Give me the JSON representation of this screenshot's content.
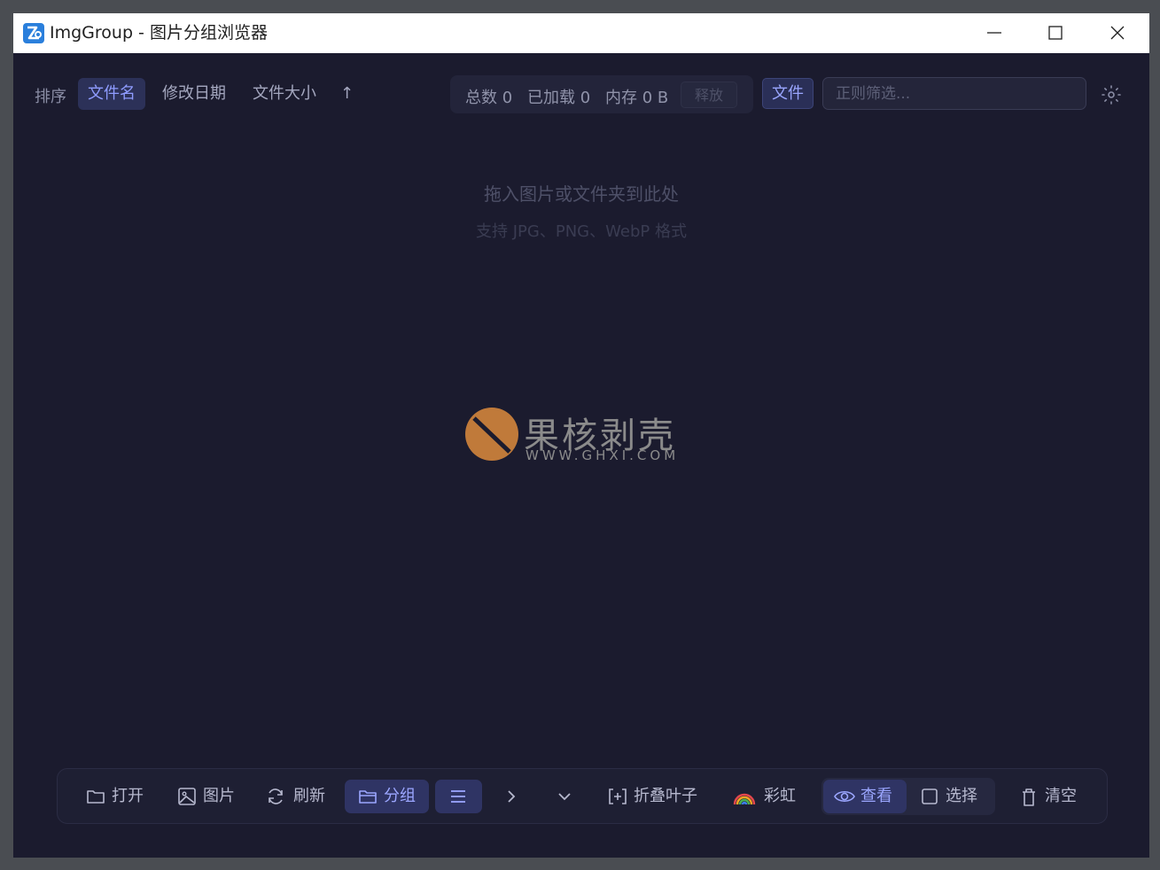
{
  "window": {
    "title": "ImgGroup - 图片分组浏览器",
    "controls": [
      "minimize",
      "maximize",
      "close"
    ]
  },
  "toolbar": {
    "sort_label": "排序",
    "sort_options": [
      {
        "label": "文件名",
        "active": true
      },
      {
        "label": "修改日期",
        "active": false
      },
      {
        "label": "文件大小",
        "active": false
      }
    ],
    "sort_direction": "↑",
    "stats": {
      "total": "总数 0",
      "loaded": "已加载 0",
      "memory": "内存 0 B",
      "release_label": "释放"
    },
    "file_button": "文件",
    "filter_placeholder": "正则筛选...",
    "settings_icon": "settings-icon"
  },
  "empty_state": {
    "title": "拖入图片或文件夹到此处",
    "subtitle": "支持 JPG、PNG、WebP 格式"
  },
  "watermark": {
    "cn": "果核剥壳",
    "en": "WWW.GHXI.COM"
  },
  "bottom_toolbar": {
    "open": "打开",
    "image": "图片",
    "refresh": "刷新",
    "group": "分组",
    "fold_leaves": "折叠叶子",
    "rainbow": "彩虹",
    "view": "查看",
    "select": "选择",
    "clear": "清空"
  },
  "colors": {
    "background": "#1b1b2e",
    "accent": "#8f9cff",
    "active_bg": "#2f3464"
  }
}
